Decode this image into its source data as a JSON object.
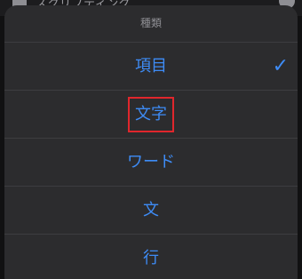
{
  "background": {
    "title": "スクリプティング"
  },
  "sheet": {
    "title": "種類",
    "options": [
      {
        "label": "項目",
        "selected": true
      },
      {
        "label": "文字",
        "selected": false
      },
      {
        "label": "ワード",
        "selected": false
      },
      {
        "label": "文",
        "selected": false
      },
      {
        "label": "行",
        "selected": false
      }
    ],
    "checkmark": "✓"
  },
  "colors": {
    "accent": "#3e8cf6",
    "highlight_box": "#e0262c",
    "sheet_bg": "#2c2c2e"
  }
}
